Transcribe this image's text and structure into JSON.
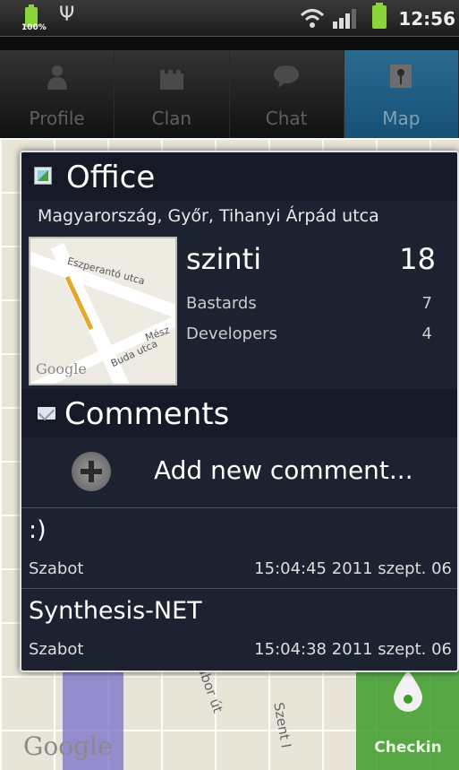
{
  "status_bar": {
    "battery_percent": "100%",
    "time": "12:56",
    "icons": [
      "battery-icon",
      "usb-icon",
      "wifi-icon",
      "signal-icon",
      "battery-icon"
    ]
  },
  "tabs": [
    {
      "label": "Profile",
      "icon": "person-icon",
      "active": false
    },
    {
      "label": "Clan",
      "icon": "castle-icon",
      "active": false
    },
    {
      "label": "Chat",
      "icon": "speech-bubble-icon",
      "active": false
    },
    {
      "label": "Map",
      "icon": "map-pin-icon",
      "active": true
    }
  ],
  "map": {
    "attribution": "Google",
    "streets": [
      "ábor út",
      "Szent I"
    ],
    "checkin_label": "Checkin"
  },
  "place": {
    "title": "Office",
    "address": "Magyarország, Győr, Tihanyi Árpád utca",
    "thumbnail_streets": [
      "Eszperantó utca",
      "Mész",
      "Buda utca",
      "Google"
    ],
    "user": "szinti",
    "score": "18",
    "groups": [
      {
        "name": "Bastards",
        "value": "7"
      },
      {
        "name": "Developers",
        "value": "4"
      }
    ]
  },
  "comments": {
    "title": "Comments",
    "add_label": "Add new comment...",
    "items": [
      {
        "text": ":)",
        "author": "Szabot",
        "timestamp": "15:04:45  2011 szept. 06"
      },
      {
        "text": "Synthesis-NET",
        "author": "Szabot",
        "timestamp": "15:04:38  2011 szept. 06"
      }
    ]
  },
  "colors": {
    "active_tab": "#165078",
    "dialog_bg": "#1d2230",
    "checkin_green": "#3c9b2a"
  }
}
